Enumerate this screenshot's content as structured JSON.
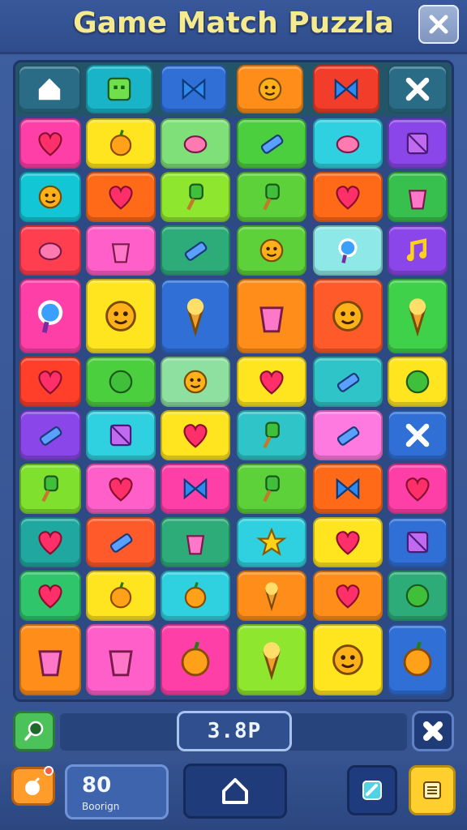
{
  "header": {
    "title": "Game Match Puzzla"
  },
  "top_row": [
    {
      "icon": "home-icon",
      "color": "#2a6b85"
    },
    {
      "icon": "green-robot-block-icon",
      "color": "#19b4c8"
    },
    {
      "icon": "red-bow-icon",
      "color": "#2f6fd6"
    },
    {
      "icon": "orange-cookie-icon",
      "color": "#ff8d1a"
    },
    {
      "icon": "wrench-icon",
      "color": "#f13d2a"
    },
    {
      "icon": "close-x-icon",
      "color": "#2a6b85"
    }
  ],
  "grid": [
    [
      "heart-icon",
      "apple-icon",
      "snail-icon",
      "candy-bar-icon",
      "spinning-top-icon",
      "cube-icon"
    ],
    [
      "cookie-face-icon",
      "heart-icon",
      "hammer-icon",
      "popsicle-icon",
      "heart-icon",
      "bottle-icon"
    ],
    [
      "bird-icon",
      "cup-icon",
      "battery-icon",
      "cookie-face-icon",
      "ring-icon",
      "music-note-icon"
    ],
    [
      "magnifier-icon",
      "character-face-icon",
      "ice-cream-cone-icon",
      "cupcake-icon",
      "pink-monster-icon",
      "leaf-pen-icon"
    ],
    [
      "heart-icon",
      "ball-icon",
      "blob-face-icon",
      "heart-icon",
      "pipe-icon",
      "cross-ball-icon"
    ],
    [
      "barcode-icon",
      "gift-box-icon",
      "heart-icon",
      "popsicle-icon",
      "pencil-icon",
      "cross-icon"
    ],
    [
      "hammer-icon",
      "heart-icon",
      "bow-icon",
      "popsicle-icon",
      "butterfly-icon",
      "heart-icon"
    ],
    [
      "heart-icon",
      "pen-icon",
      "bag-icon",
      "star-icon",
      "heart-icon",
      "check-board-icon"
    ],
    [
      "heart-icon",
      "apple-icon",
      "apple-icon",
      "carrot-icon",
      "heart-icon",
      "blob-icon"
    ],
    [
      "gift-bag-icon",
      "candy-jar-icon",
      "tomato-face-icon",
      "carrot-icon",
      "cupcake-monster-icon",
      "apple-icon"
    ]
  ],
  "colors": {
    "rows": [
      [
        "#ff3fa8",
        "#ffe51f",
        "#7fe07a",
        "#4ccf3f",
        "#2fd1e0",
        "#8a46e8"
      ],
      [
        "#13c6d6",
        "#ff6a19",
        "#8ee62e",
        "#5cd13a",
        "#ff6a19",
        "#37c04e"
      ],
      [
        "#ff3f4f",
        "#ff5fc8",
        "#2dac7a",
        "#5cd13a",
        "#8fe8e8",
        "#8a46e8"
      ],
      [
        "#ff3fa8",
        "#ffe51f",
        "#2f6fd6",
        "#ff8d1a",
        "#ff5a2a",
        "#3fd14a"
      ],
      [
        "#ff3f2a",
        "#4ccf3f",
        "#8de0a0",
        "#ffe51f",
        "#2fc5c8",
        "#ffe51f"
      ],
      [
        "#8a46e8",
        "#2fd1e0",
        "#ffe51f",
        "#2fc5c8",
        "#ff7ae0",
        "#2f6fd6"
      ],
      [
        "#7fe02e",
        "#ff5fc8",
        "#ff3fa8",
        "#5cd13a",
        "#ff6a19",
        "#ff3fa8"
      ],
      [
        "#20a8a0",
        "#ff5a2a",
        "#2dac7a",
        "#2fd1e0",
        "#ffe51f",
        "#2f6fd6"
      ],
      [
        "#2fc56a",
        "#ffe51f",
        "#2fd1e0",
        "#ff8d1a",
        "#ff8d1a",
        "#2dac7a"
      ],
      [
        "#ff8d1a",
        "#ff5fc8",
        "#ff3fa8",
        "#8ee62e",
        "#ffe51f",
        "#2f6fd6"
      ]
    ]
  },
  "hud": {
    "score": "3.8P",
    "moves_value": "80",
    "moves_label": "Boorign"
  }
}
